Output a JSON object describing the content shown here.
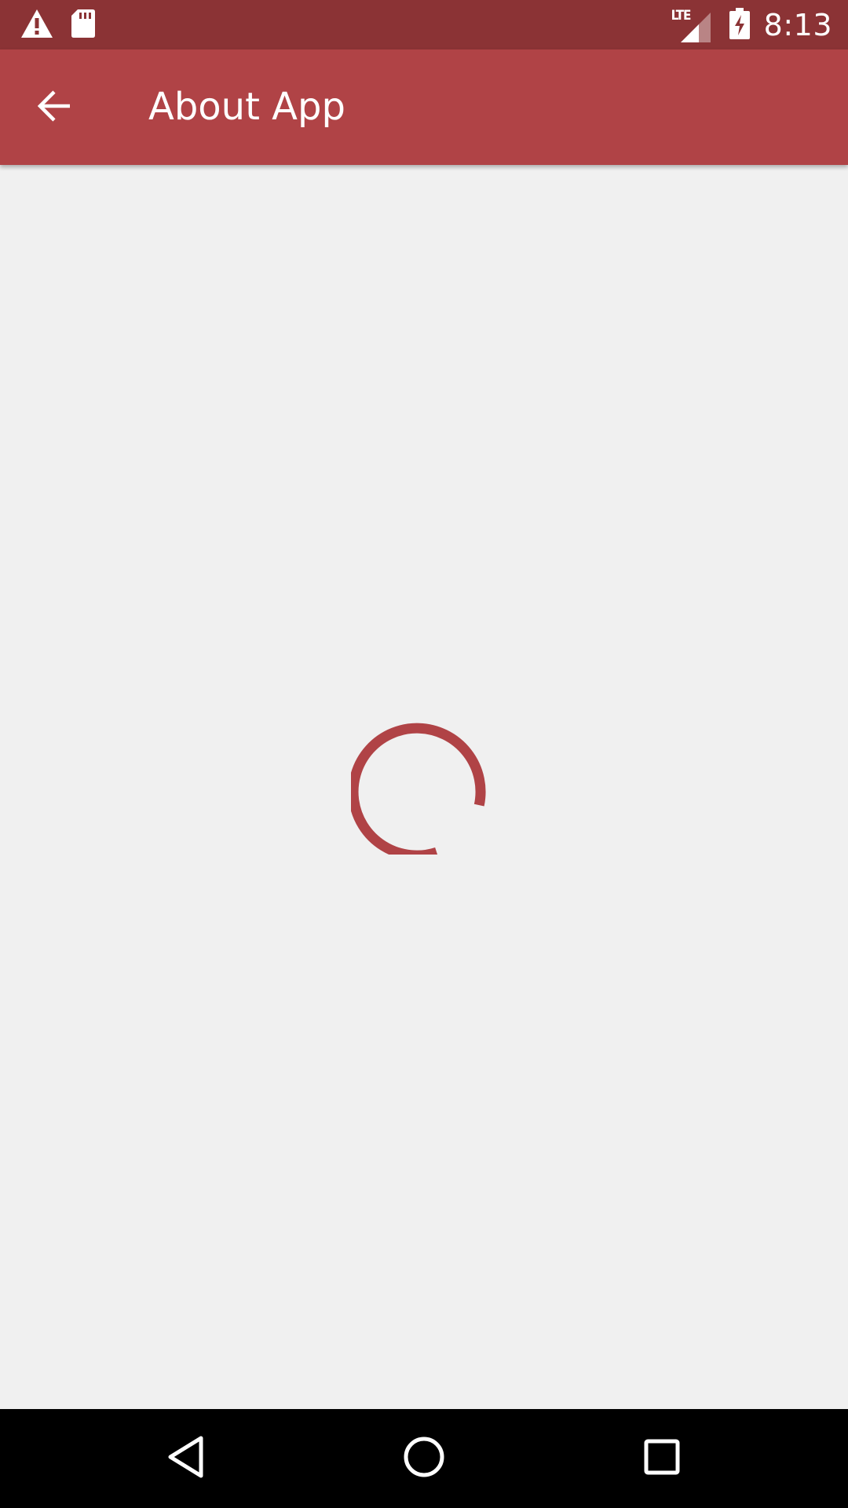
{
  "status_bar": {
    "left_icons": [
      "warning-icon",
      "sd-card-icon"
    ],
    "right_icons": [
      "lte-signal-icon",
      "battery-charging-icon"
    ],
    "network_label": "LTE",
    "time": "8:13"
  },
  "app_bar": {
    "back_icon": "arrow-back-icon",
    "title": "About App"
  },
  "content": {
    "state": "loading",
    "spinner_icon": "progress-spinner"
  },
  "nav_bar": {
    "buttons": [
      "back-triangle-icon",
      "home-circle-icon",
      "recents-square-icon"
    ]
  },
  "colors": {
    "status_bar": "#8b3335",
    "app_bar": "#b04346",
    "accent": "#b04346",
    "background": "#f0f0f0",
    "nav_bar": "#000000"
  }
}
